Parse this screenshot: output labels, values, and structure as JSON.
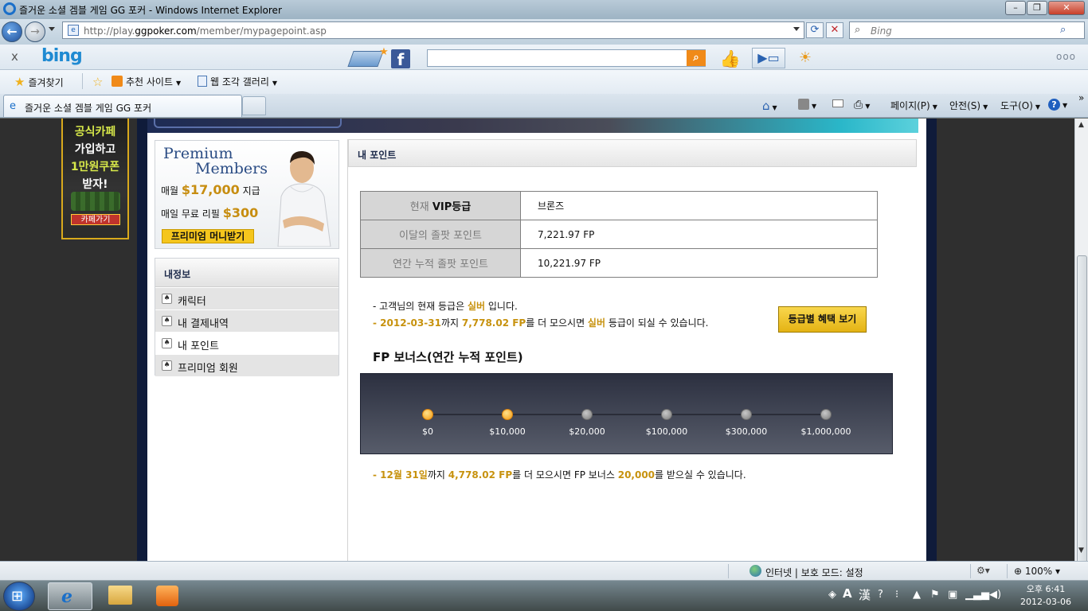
{
  "window": {
    "title": "즐거운 소셜 겜블 게임 GG 포커 - Windows Internet Explorer",
    "minimize": "–",
    "maximize": "❐",
    "close": "✕"
  },
  "address": {
    "url_prefix": "http://play.",
    "url_domain": "ggpoker.com",
    "url_path": "/member/mypagepoint.asp",
    "search_placeholder": "Bing"
  },
  "bing_toolbar": {
    "close": "x",
    "logo": "bing",
    "more": "ooo",
    "icons": [
      "mail-icon",
      "facebook-icon",
      "like-icon",
      "video-icon",
      "weather-icon"
    ]
  },
  "favorites": {
    "favorites_label": "즐겨찾기",
    "suggested_sites": "추천 사이트",
    "web_slice_gallery": "웹 조각 갤러리"
  },
  "tab": {
    "title": "즐거운 소셜 겜블 게임 GG 포커"
  },
  "commands": {
    "page": "페이지(P)",
    "safety": "안전(S)",
    "tools": "도구(O)",
    "help": "?"
  },
  "cafe_banner": {
    "line1": "공식카페",
    "line2": "가입하고",
    "line3": "1만원쿠폰",
    "line4": "받자!",
    "button": "카페가기"
  },
  "premium": {
    "title1": "Premium",
    "title2": "Members",
    "row1_prefix": "매월 ",
    "row1_price": "$17,000",
    "row1_suffix": " 지급",
    "row2_prefix": "매일 무료 리필 ",
    "row2_price": "$300",
    "button": "프리미엄 머니받기"
  },
  "left_menu": {
    "header": "내정보",
    "items": [
      {
        "label": "캐릭터",
        "selected": false
      },
      {
        "label": "내 결제내역",
        "selected": false
      },
      {
        "label": "내 포인트",
        "selected": true
      },
      {
        "label": "프리미엄 회원",
        "selected": false
      }
    ]
  },
  "content": {
    "header": "내 포인트",
    "table": [
      {
        "key_prefix": "현재 ",
        "key_bold": "VIP등급",
        "value": "브론즈"
      },
      {
        "key_prefix": "이달의 졸팟 포인트",
        "key_bold": "",
        "value": "7,221.97 FP"
      },
      {
        "key_prefix": "연간 누적 졸팟 포인트",
        "key_bold": "",
        "value": "10,221.97 FP"
      }
    ],
    "note1_a": "- 고객님의 현재 등급은 ",
    "note1_grade": "실버",
    "note1_b": " 입니다.",
    "note2_dash": "- ",
    "note2_date": "2012-03-31",
    "note2_a": "까지 ",
    "note2_fp": "7,778.02 FP",
    "note2_b": "를 더 모으시면 ",
    "note2_grade": "실버",
    "note2_c": " 등급이 되실 수 있습니다.",
    "tier_button": "등급별 혜택 보기",
    "bonus_title": "FP 보너스(연간 누적 포인트)",
    "bonus_ticks": [
      {
        "label": "$0",
        "reached": true
      },
      {
        "label": "$10,000",
        "reached": true
      },
      {
        "label": "$20,000",
        "reached": false
      },
      {
        "label": "$100,000",
        "reached": false
      },
      {
        "label": "$300,000",
        "reached": false
      },
      {
        "label": "$1,000,000",
        "reached": false
      }
    ],
    "bonus_note_dash": "- ",
    "bonus_note_date": "12월 31일",
    "bonus_note_a": "까지 ",
    "bonus_note_fp": "4,778.02 FP",
    "bonus_note_b": "를 더 모으시면 FP 보너스 ",
    "bonus_note_amount": "20,000",
    "bonus_note_c": "를 받으실 수 있습니다."
  },
  "status": {
    "zone": "인터넷 | 보호 모드: 설정",
    "zoom": "100%"
  },
  "taskbar": {
    "time": "오후 6:41",
    "date": "2012-03-06"
  }
}
